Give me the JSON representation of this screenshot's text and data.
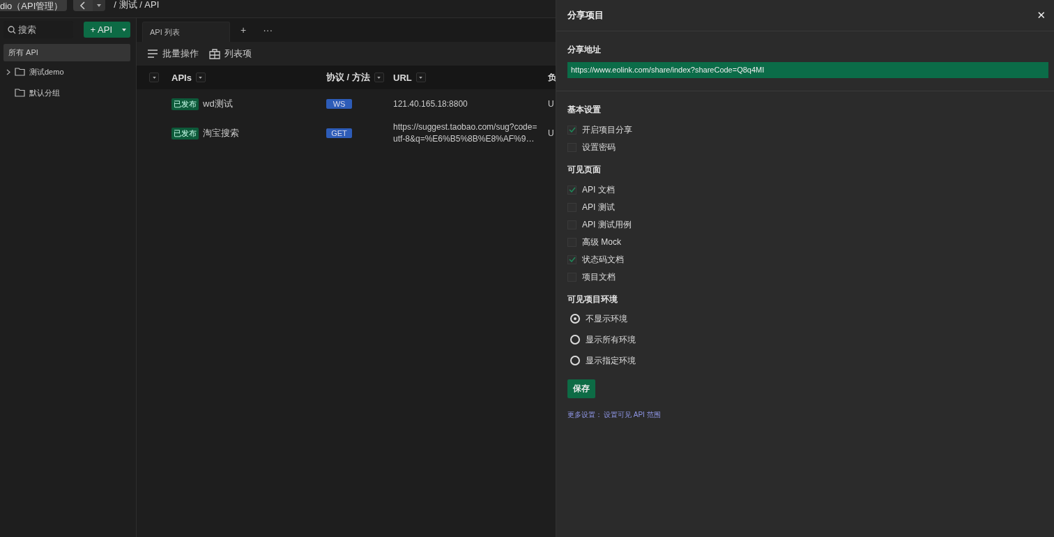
{
  "top_bar": {
    "app_button": "dio（API管理）",
    "breadcrumb": "/ 测试 / API"
  },
  "sidebar": {
    "search": {
      "placeholder": "搜索"
    },
    "add_button": "+ API",
    "all_item": {
      "label": "所有 API",
      "selected": true
    },
    "tree": [
      {
        "label": "测试demo",
        "has_children": true
      },
      {
        "label": "默认分组",
        "has_children": false
      }
    ]
  },
  "tabs": [
    {
      "label": "API 列表",
      "selected": true
    }
  ],
  "tab_actions": [
    "+",
    "···"
  ],
  "toolbar": [
    "批量操作",
    "列表项"
  ],
  "table": {
    "columns": [
      "APIs",
      "协议 / 方法",
      "URL",
      "负"
    ],
    "rows": [
      {
        "status": "已发布",
        "name": "wd测试",
        "method": "WS",
        "url": "121.40.165.18:8800",
        "column_4": "U"
      },
      {
        "status": "已发布",
        "name": "淘宝搜索",
        "method": "GET",
        "url": "https://suggest.taobao.com/sug?code=utf-8&q=%E6%B5%8B%E8%AF%9…",
        "column_4": "U"
      }
    ]
  },
  "share_panel": {
    "title": "分享项目",
    "close": "✕",
    "address_label": "分享地址",
    "address": "https://www.eolink.com/share/index?shareCode=Q8q4MI",
    "basic_title": "基本设置",
    "basic": [
      {
        "label": "开启项目分享",
        "checked": true
      },
      {
        "label": "设置密码",
        "checked": false
      }
    ],
    "pages_title": "可见页面",
    "pages": [
      {
        "label": "API 文档",
        "checked": true
      },
      {
        "label": "API 测试",
        "checked": false
      },
      {
        "label": "API 测试用例",
        "checked": false
      },
      {
        "label": "高级 Mock",
        "checked": false
      },
      {
        "label": "状态码文档",
        "checked": true
      },
      {
        "label": "项目文档",
        "checked": false
      }
    ],
    "env_title": "可见项目环境",
    "envs": [
      {
        "label": "不显示环境",
        "selected": true
      },
      {
        "label": "显示所有环境",
        "selected": false
      },
      {
        "label": "显示指定环境",
        "selected": false
      }
    ],
    "save": "保存",
    "more_label": "更多设置：",
    "more_link": "设置可见 API 范围"
  }
}
